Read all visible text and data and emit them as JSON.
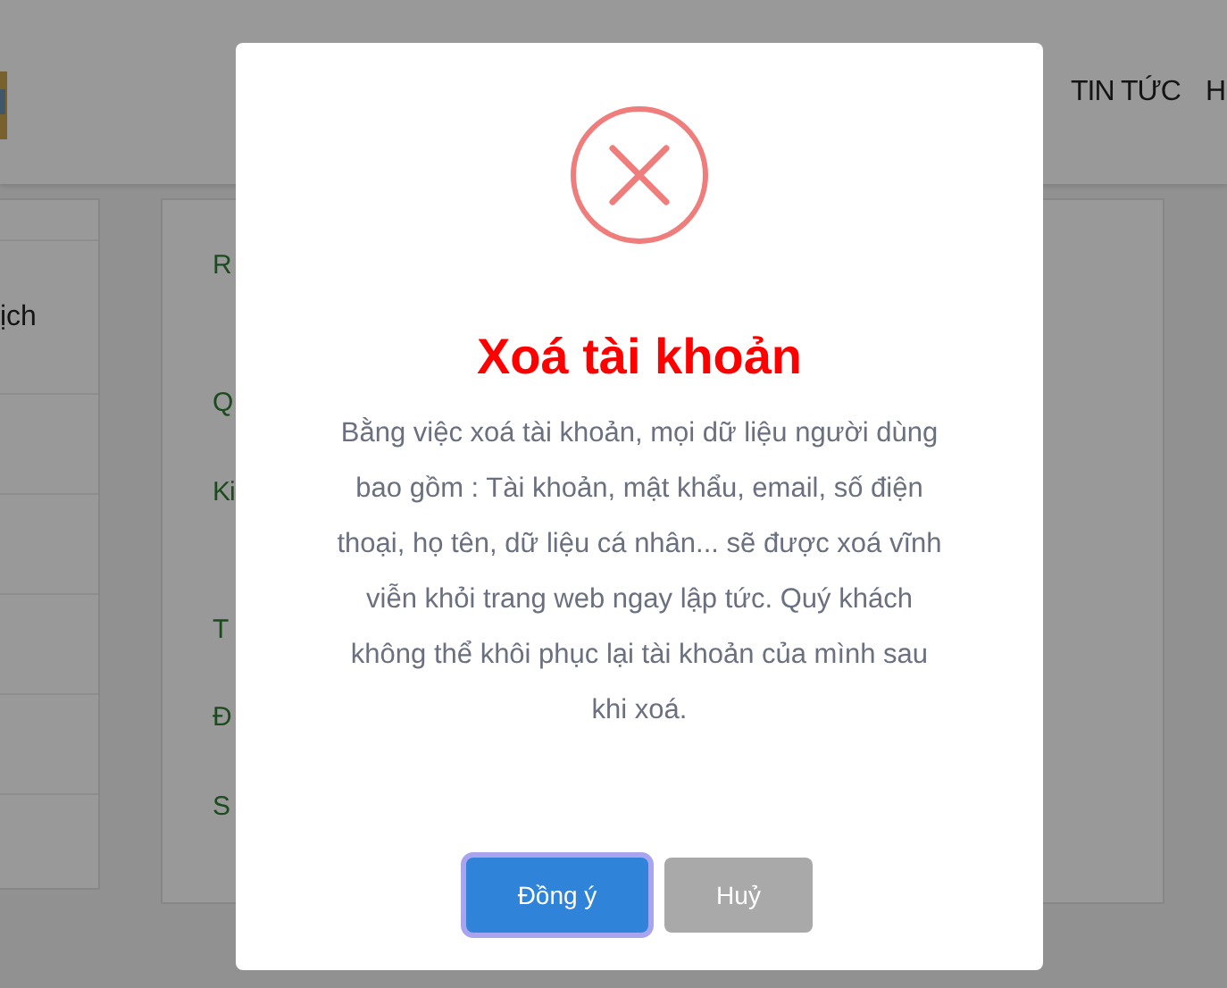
{
  "header": {
    "nav": [
      "TIN TỨC",
      "H"
    ]
  },
  "sidebar": {
    "items": [
      "ịch"
    ]
  },
  "main": {
    "items": [
      "R",
      "Q",
      "Ki",
      "T",
      "Đ",
      "S"
    ]
  },
  "dialog": {
    "title": "Xoá tài khoản",
    "message": "Bằng việc xoá tài khoản, mọi dữ liệu người dùng bao gồm : Tài khoản, mật khẩu, email, số điện thoại, họ tên, dữ liệu cá nhân... sẽ được xoá vĩnh viễn khỏi trang web ngay lập tức. Quý khách không thể khôi phục lại tài khoản của mình sau khi xoá.",
    "buttons": [
      {
        "label": "Đồng ý",
        "kind": "primary",
        "focused": true
      },
      {
        "label": "Huỷ",
        "kind": "secondary",
        "focused": false
      }
    ]
  }
}
